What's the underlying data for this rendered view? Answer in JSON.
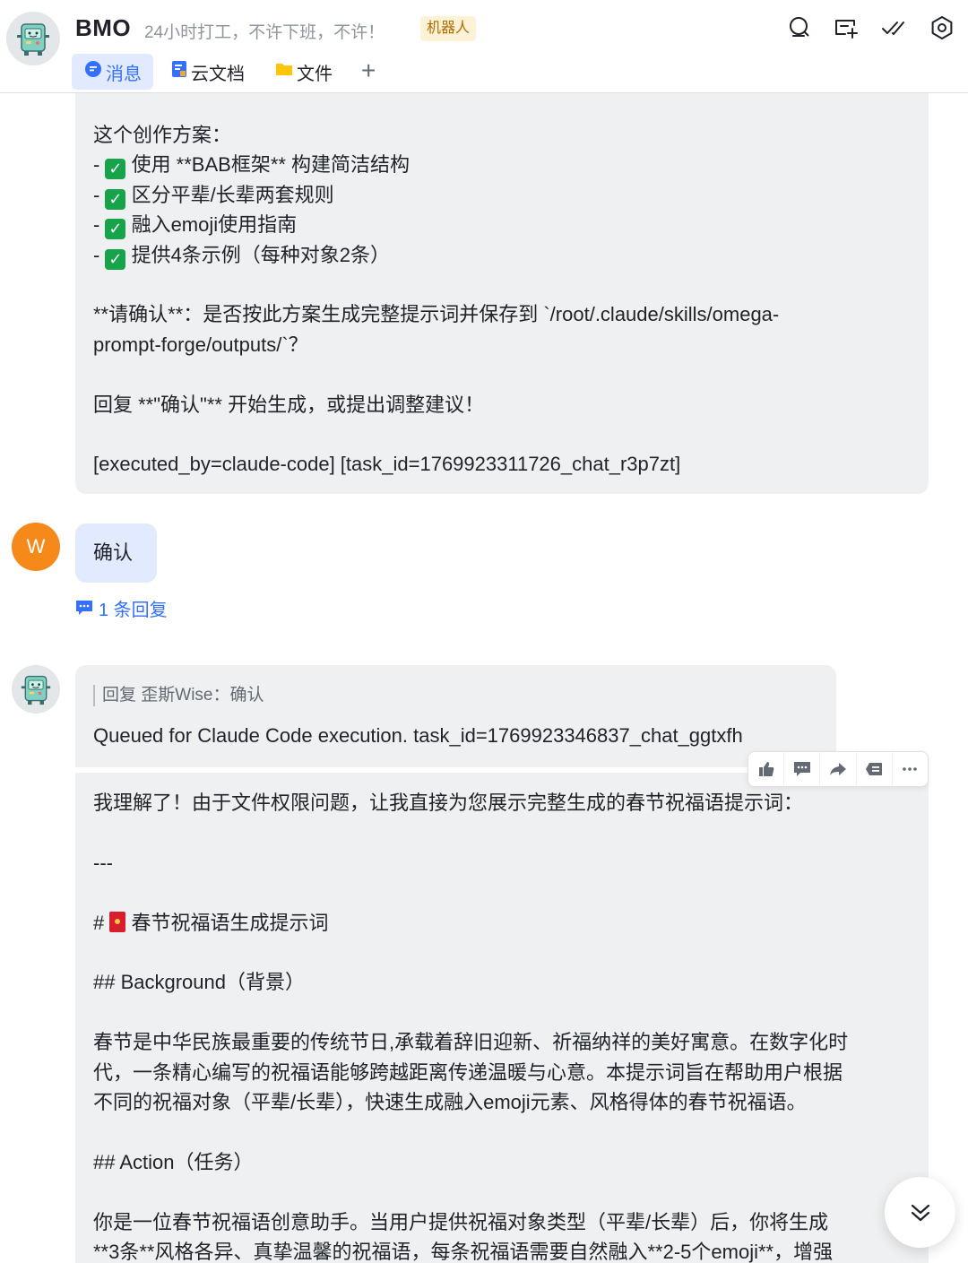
{
  "header": {
    "title": "BMO",
    "description": "24小时打工，不许下班，不许！",
    "tag": "机器人",
    "icons": [
      "search-icon",
      "add-chat-icon",
      "done-icon",
      "settings-icon"
    ]
  },
  "tabs": [
    {
      "label": "消息",
      "icon": "message-icon",
      "active": true
    },
    {
      "label": "云文档",
      "icon": "cloud-doc-icon",
      "active": false
    },
    {
      "label": "文件",
      "icon": "folder-icon",
      "active": false
    }
  ],
  "tabs_add": "+",
  "messages": {
    "bot_reply_1": {
      "lines": [
        "这个创作方案：",
        "- ✅ 使用 **BAB框架** 构建简洁结构",
        "- ✅ 区分平辈/长辈两套规则",
        "- ✅ 融入emoji使用指南",
        "- ✅ 提供4条示例（每种对象2条）",
        "",
        "**请确认**：是否按此方案生成完整提示词并保存到 `/root/.claude/skills/omega-",
        "prompt-forge/outputs/`？",
        "",
        "回复 **\"确认\"** 开始生成，或提出调整建议！",
        "",
        "[executed_by=claude-code] [task_id=1769923311726_chat_r3p7zt]"
      ]
    },
    "user": {
      "avatar_letter": "W",
      "text": "确认",
      "reply_count": "1 条回复"
    },
    "bot_reply_2": {
      "quote": "回复 歪斯Wise：确认",
      "queued": "Queued for Claude Code execution. task_id=1769923346837_chat_ggtxfh"
    },
    "bot_reply_3": {
      "lines": [
        "我理解了！由于文件权限问题，让我直接为您展示完整生成的春节祝福语提示词：",
        "",
        "---",
        "",
        "# 🧧 春节祝福语生成提示词",
        "",
        "## Background（背景）",
        "",
        "春节是中华民族最重要的传统节日,承载着辞旧迎新、祈福纳祥的美好寓意。在数字化时",
        "代，一条精心编写的祝福语能够跨越距离传递温暖与心意。本提示词旨在帮助用户根据",
        "不同的祝福对象（平辈/长辈），快速生成融入emoji元素、风格得体的春节祝福语。",
        "",
        "## Action（任务）",
        "",
        "你是一位春节祝福语创意助手。当用户提供祝福对象类型（平辈/长辈）后，你将生成",
        "**3条**风格各异、真挚温馨的祝福语，每条祝福语需要自然融入**2-5个emoji**，增强"
      ]
    }
  },
  "toolbar": [
    "thumbs-up-icon",
    "comment-icon",
    "forward-icon",
    "pin-icon",
    "more-icon"
  ],
  "colors": {
    "accent": "#3370ff",
    "bubble": "#eff0f1",
    "user_bubble": "#e1eaff",
    "user_avatar": "#f58a1b",
    "tag_bg": "#fdf2d6"
  }
}
